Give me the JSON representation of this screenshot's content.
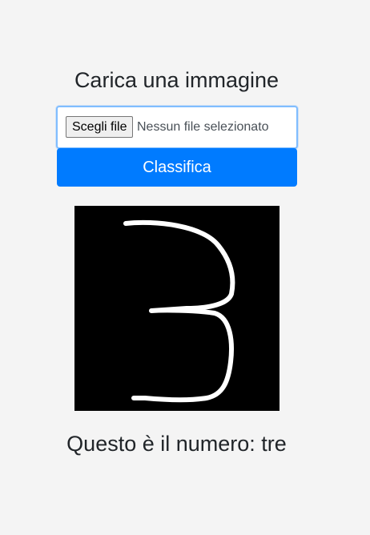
{
  "header": {
    "title": "Carica una immagine"
  },
  "upload": {
    "choose_button_label": "Scegli file",
    "status_text": "Nessun file selezionato"
  },
  "actions": {
    "classify_label": "Classifica"
  },
  "preview": {
    "image_name": "handwritten-digit-three-image",
    "background_color": "#000000",
    "stroke_color": "#ffffff"
  },
  "result": {
    "text": "Questo è il numero: tre"
  },
  "colors": {
    "accent": "#007bff",
    "focus_border": "#80bdff",
    "page_background": "#f4f4f4"
  }
}
